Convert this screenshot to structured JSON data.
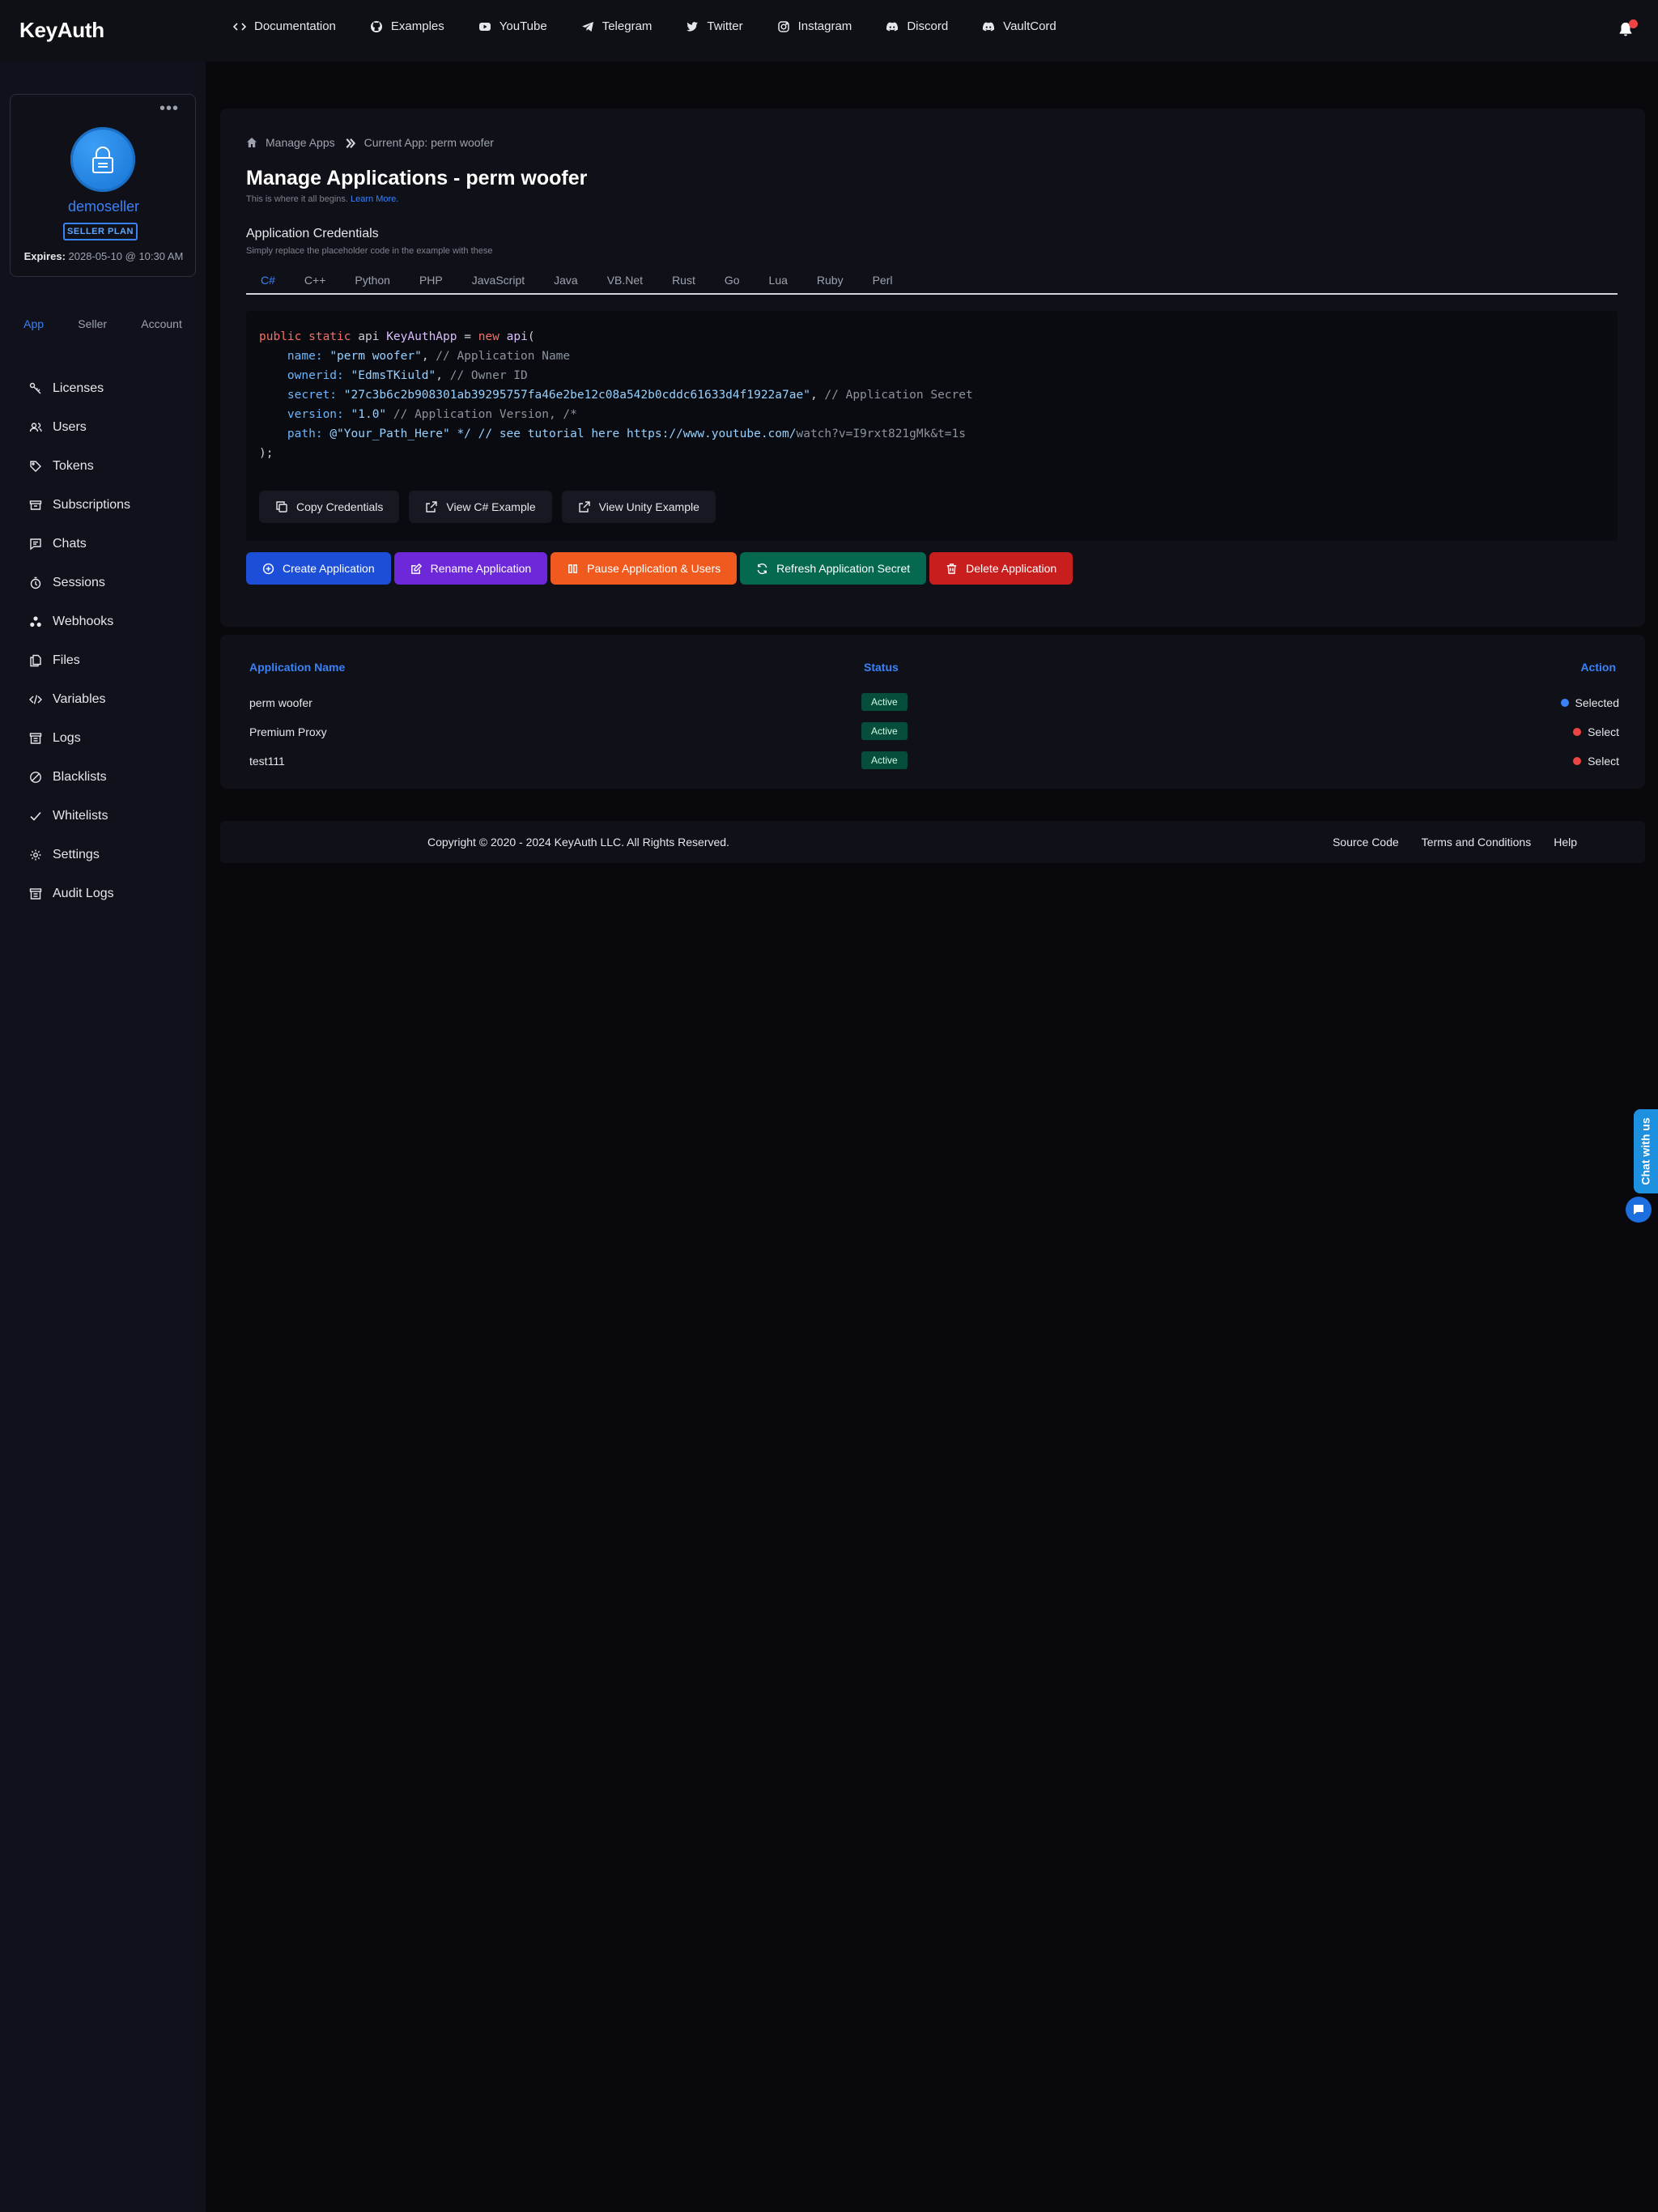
{
  "brand": {
    "logo": "KeyAuth"
  },
  "topnav": [
    {
      "label": "Documentation",
      "icon": "code-icon"
    },
    {
      "label": "Examples",
      "icon": "github-icon"
    },
    {
      "label": "YouTube",
      "icon": "youtube-icon"
    },
    {
      "label": "Telegram",
      "icon": "telegram-icon"
    },
    {
      "label": "Twitter",
      "icon": "twitter-icon"
    },
    {
      "label": "Instagram",
      "icon": "instagram-icon"
    },
    {
      "label": "Discord",
      "icon": "discord-icon"
    },
    {
      "label": "VaultCord",
      "icon": "discord-icon"
    }
  ],
  "profile": {
    "username": "demoseller",
    "plan": "SELLER PLAN",
    "expires_label": "Expires:",
    "expires_value": "2028-05-10 @ 10:30 AM"
  },
  "sidebar": {
    "tabs": [
      "App",
      "Seller",
      "Account"
    ],
    "active_tab": "App",
    "items": [
      {
        "label": "Licenses",
        "icon": "key-icon"
      },
      {
        "label": "Users",
        "icon": "users-icon"
      },
      {
        "label": "Tokens",
        "icon": "tag-icon"
      },
      {
        "label": "Subscriptions",
        "icon": "archive-icon"
      },
      {
        "label": "Chats",
        "icon": "chat-icon"
      },
      {
        "label": "Sessions",
        "icon": "clock-icon"
      },
      {
        "label": "Webhooks",
        "icon": "webhook-icon"
      },
      {
        "label": "Files",
        "icon": "files-icon"
      },
      {
        "label": "Variables",
        "icon": "code-icon"
      },
      {
        "label": "Logs",
        "icon": "logs-icon"
      },
      {
        "label": "Blacklists",
        "icon": "ban-icon"
      },
      {
        "label": "Whitelists",
        "icon": "check-icon"
      },
      {
        "label": "Settings",
        "icon": "gear-icon"
      },
      {
        "label": "Audit Logs",
        "icon": "logs-icon"
      }
    ]
  },
  "breadcrumb": {
    "root": "Manage Apps",
    "current": "Current App: perm woofer"
  },
  "page": {
    "title": "Manage Applications - perm woofer",
    "subtitle": "This is where it all begins.",
    "learn_more": "Learn More."
  },
  "credentials": {
    "title": "Application Credentials",
    "subtitle": "Simply replace the placeholder code in the example with these",
    "languages": [
      "C#",
      "C++",
      "Python",
      "PHP",
      "JavaScript",
      "Java",
      "VB.Net",
      "Rust",
      "Go",
      "Lua",
      "Ruby",
      "Perl"
    ],
    "active_language": "C#",
    "code": {
      "l1_public": "public",
      "l1_static": "static",
      "l1_api": "api",
      "l1_class": "KeyAuthApp",
      "l1_eq": "=",
      "l1_new": "new",
      "l1_ctor": "api",
      "l1_paren": "(",
      "name_key": "name:",
      "name_val": "\"perm woofer\"",
      "name_comment": "// Application Name",
      "owner_key": "ownerid:",
      "owner_val": "\"EdmsTKiuld\"",
      "owner_comment": "// Owner ID",
      "secret_key": "secret:",
      "secret_val": "\"27c3b6c2b908301ab39295757fa46e2be12c08a542b0cddc61633d4f1922a7ae\"",
      "secret_comment": "// Application Secret",
      "version_key": "version:",
      "version_val": "\"1.0\"",
      "version_comment": "// Application Version, /*",
      "path_key": "path:",
      "path_val": "@\"Your_Path_Here\"",
      "path_comment": "*/ // see tutorial here https://www.youtube.com/",
      "path_tail": "watch?v=I9rxt821gMk&t=1s",
      "close": ");"
    },
    "buttons": {
      "copy": "Copy Credentials",
      "view_example": "View C# Example",
      "view_unity": "View Unity Example"
    }
  },
  "actions": {
    "create": "Create Application",
    "rename": "Rename Application",
    "pause": "Pause Application & Users",
    "refresh": "Refresh Application Secret",
    "delete": "Delete Application"
  },
  "apps_table": {
    "headers": {
      "name": "Application Name",
      "status": "Status",
      "action": "Action"
    },
    "rows": [
      {
        "name": "perm woofer",
        "status": "Active",
        "action": "Selected",
        "dot_color": "#3b82f6"
      },
      {
        "name": "Premium Proxy",
        "status": "Active",
        "action": "Select",
        "dot_color": "#ef4444"
      },
      {
        "name": "test111",
        "status": "Active",
        "action": "Select",
        "dot_color": "#ef4444"
      }
    ]
  },
  "footer": {
    "copyright": "Copyright © 2020 - 2024 KeyAuth LLC. All Rights Reserved.",
    "links": [
      "Source Code",
      "Terms and Conditions",
      "Help"
    ]
  },
  "chat_widget": {
    "label": "Chat with us"
  },
  "colors": {
    "accent": "#3b82f6",
    "create": "#1d4ed8",
    "rename": "#6d28d9",
    "pause": "#f05a1e",
    "refresh": "#04694f",
    "delete": "#c81e1e",
    "status_active": "#064e3b"
  }
}
